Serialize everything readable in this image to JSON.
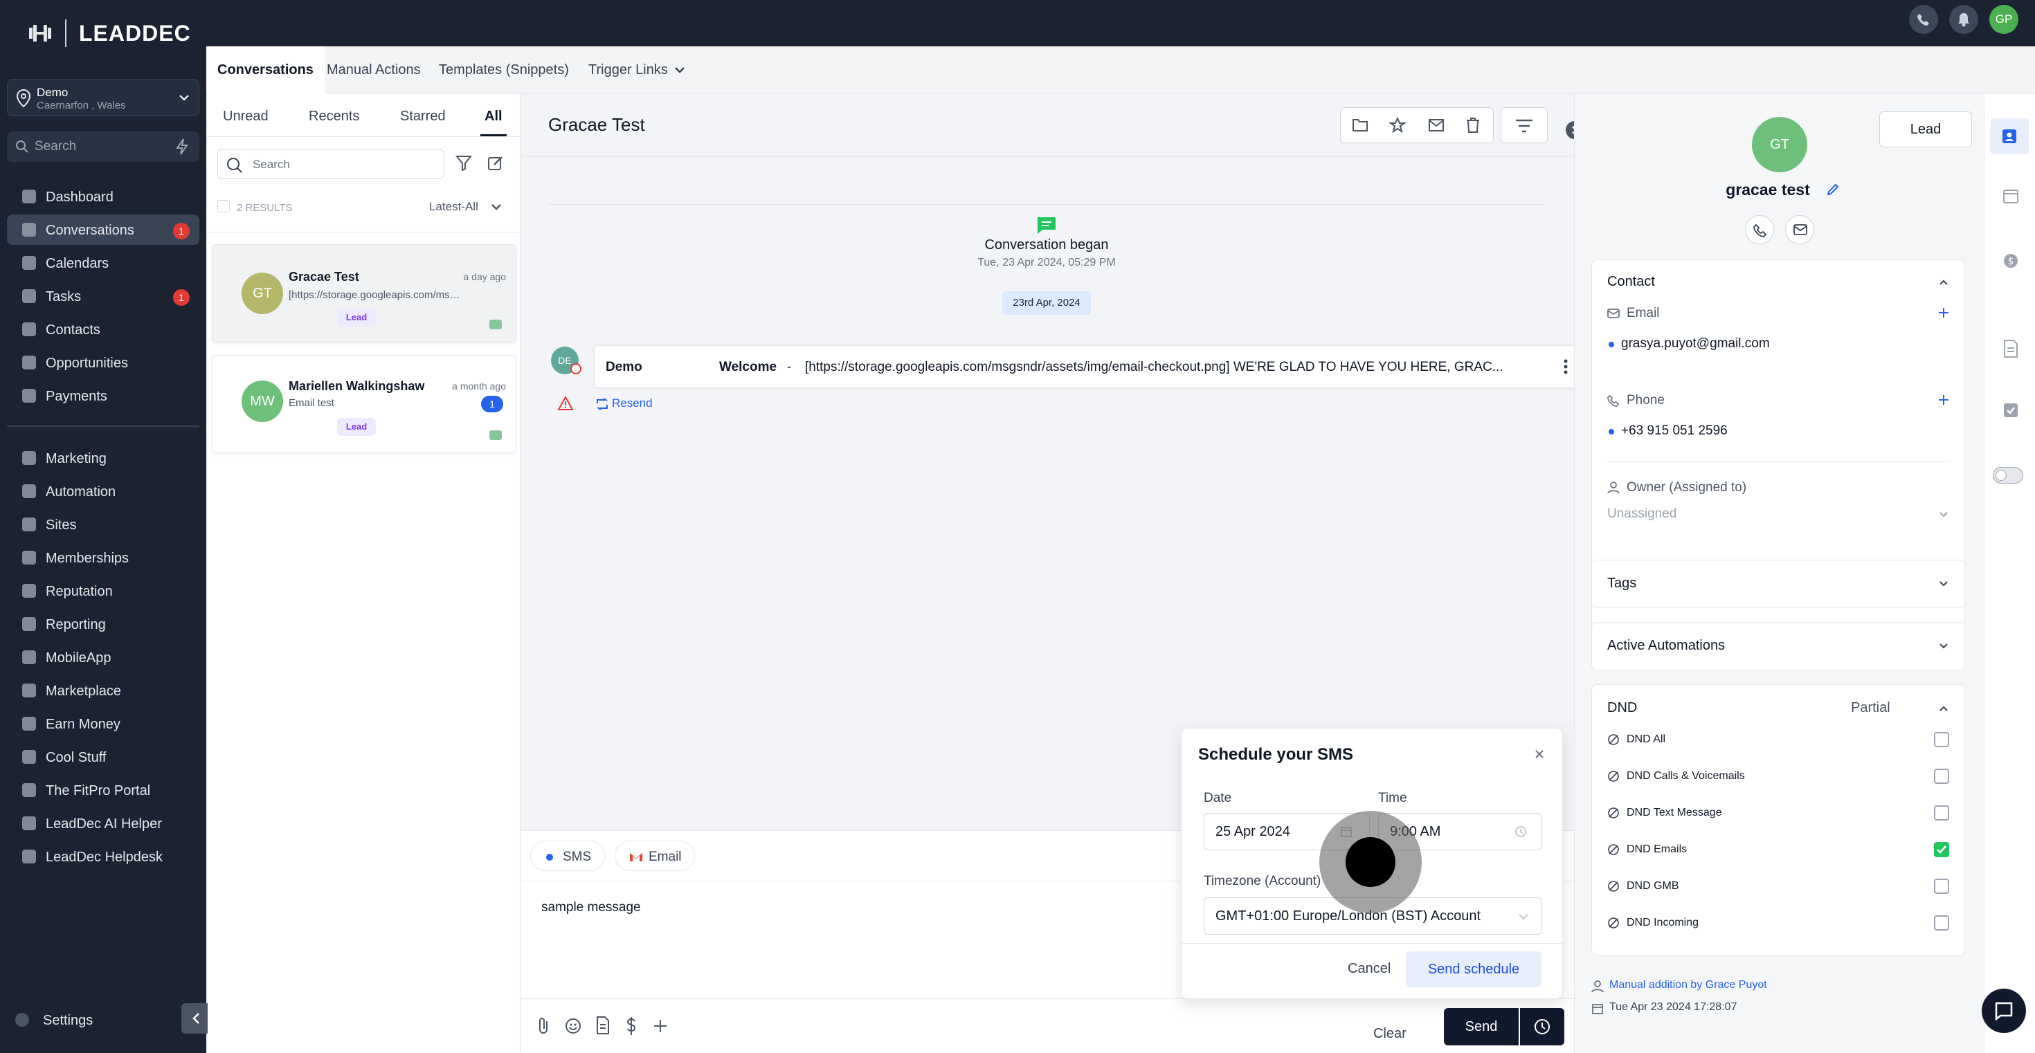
{
  "app": {
    "brand": "LEADDEC",
    "location": {
      "name": "Demo",
      "sub": "Caernarfon , Wales"
    },
    "search_placeholder": "Search",
    "nav": [
      {
        "label": "Dashboard",
        "icon": "dashboard-icon"
      },
      {
        "label": "Conversations",
        "icon": "chat-icon",
        "badge": "1",
        "active": true
      },
      {
        "label": "Calendars",
        "icon": "calendar-icon"
      },
      {
        "label": "Tasks",
        "icon": "tasks-icon",
        "badge": "1"
      },
      {
        "label": "Contacts",
        "icon": "contacts-icon"
      },
      {
        "label": "Opportunities",
        "icon": "filter-icon"
      },
      {
        "label": "Payments",
        "icon": "payments-icon"
      },
      {
        "label": "Marketing",
        "icon": "marketing-icon"
      },
      {
        "label": "Automation",
        "icon": "automation-icon"
      },
      {
        "label": "Sites",
        "icon": "sites-icon"
      },
      {
        "label": "Memberships",
        "icon": "memberships-icon"
      },
      {
        "label": "Reputation",
        "icon": "reputation-icon"
      },
      {
        "label": "Reporting",
        "icon": "reporting-icon"
      },
      {
        "label": "MobileApp",
        "icon": "mobile-icon"
      },
      {
        "label": "Marketplace",
        "icon": "cart-icon"
      },
      {
        "label": "Earn Money",
        "icon": "money-icon"
      },
      {
        "label": "Cool Stuff",
        "icon": "fire-icon"
      },
      {
        "label": "The FitPro Portal",
        "icon": "dumbbell-icon"
      },
      {
        "label": "LeadDec AI Helper",
        "icon": "robot-icon"
      },
      {
        "label": "LeadDec Helpdesk",
        "icon": "info-icon"
      }
    ],
    "settings_label": "Settings",
    "user_initials": "GP"
  },
  "tabs": [
    "Conversations",
    "Manual Actions",
    "Templates (Snippets)",
    "Trigger Links"
  ],
  "list": {
    "filters": [
      "Unread",
      "Recents",
      "Starred",
      "All"
    ],
    "search_placeholder": "Search",
    "results": "2 RESULTS",
    "sort": "Latest-All",
    "items": [
      {
        "initials": "GT",
        "name": "Gracae Test",
        "time": "a day ago",
        "preview": "[https://storage.googleapis.com/msgsndr/assets/img/email-checkout.png]",
        "tag": "Lead",
        "color": "#b5b86a"
      },
      {
        "initials": "MW",
        "name": "Mariellen Walkingshaw",
        "time": "a month ago",
        "preview": "Email test",
        "tag": "Lead",
        "unread": "1",
        "color": "#6dbf7a"
      }
    ]
  },
  "chat": {
    "title": "Gracae Test",
    "began_label": "Conversation began",
    "began_time": "Tue, 23 Apr 2024, 05:29 PM",
    "date_pill": "23rd Apr, 2024",
    "message": {
      "initials": "DE",
      "sender": "Demo",
      "subject": "Welcome",
      "body": "[https://storage.googleapis.com/msgsndr/assets/img/email-checkout.png] WE'RE GLAD TO HAVE YOU HERE, GRAC..."
    },
    "resend": "Resend"
  },
  "composer": {
    "channels": [
      "SMS",
      "Email"
    ],
    "text": "sample message",
    "clear": "Clear",
    "send": "Send"
  },
  "schedule": {
    "title": "Schedule your SMS",
    "date_label": "Date",
    "date_value": "25 Apr 2024",
    "time_label": "Time",
    "time_value": "9:00 AM",
    "tz_label": "Timezone (Account)",
    "tz_value": "GMT+01:00 Europe/London (BST) Account",
    "cancel": "Cancel",
    "submit": "Send schedule"
  },
  "contact": {
    "initials": "GT",
    "name": "gracae test",
    "lead_button": "Lead",
    "section_contact": "Contact",
    "email_label": "Email",
    "email": "grasya.puyot@gmail.com",
    "phone_label": "Phone",
    "phone": "+63 915 051 2596",
    "owner_label": "Owner (Assigned to)",
    "owner": "Unassigned",
    "tags": "Tags",
    "automations": "Active Automations",
    "dnd": "DND",
    "dnd_status": "Partial",
    "dnd_items": [
      {
        "label": "DND All",
        "checked": false
      },
      {
        "label": "DND Calls & Voicemails",
        "checked": false
      },
      {
        "label": "DND Text Message",
        "checked": false
      },
      {
        "label": "DND Emails",
        "checked": true
      },
      {
        "label": "DND GMB",
        "checked": false
      },
      {
        "label": "DND Incoming",
        "checked": false
      }
    ],
    "manual_addition": "Manual addition by Grace Puyot",
    "added_time": "Tue Apr 23 2024 17:28:07"
  },
  "colors": {
    "sidebar": "#1b2333",
    "accent": "#2563eb",
    "green": "#22c55e",
    "danger": "#e53935"
  }
}
